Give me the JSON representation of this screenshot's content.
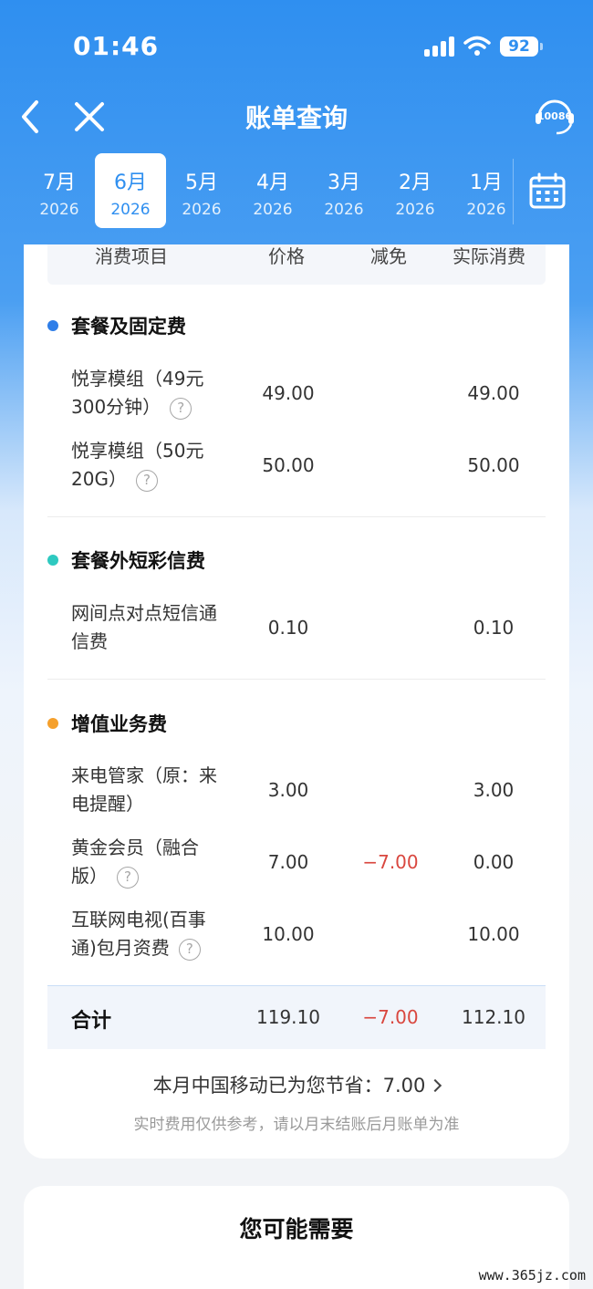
{
  "status_bar": {
    "time": "01:46",
    "battery": "92"
  },
  "nav": {
    "title": "账单查询",
    "hotline": "10086"
  },
  "months": [
    {
      "month": "7月",
      "year": "2026",
      "active": false
    },
    {
      "month": "6月",
      "year": "2026",
      "active": true
    },
    {
      "month": "5月",
      "year": "2026",
      "active": false
    },
    {
      "month": "4月",
      "year": "2026",
      "active": false
    },
    {
      "month": "3月",
      "year": "2026",
      "active": false
    },
    {
      "month": "2月",
      "year": "2026",
      "active": false
    },
    {
      "month": "1月",
      "year": "2026",
      "active": false
    }
  ],
  "table": {
    "headers": {
      "item": "消费项目",
      "price": "价格",
      "discount": "减免",
      "actual": "实际消费"
    }
  },
  "sections": [
    {
      "title": "套餐及固定费",
      "dot_color": "#2f7ee8",
      "items": [
        {
          "name_line1": "悦享模组（49元",
          "name_line2": "300分钟）",
          "price": "49.00",
          "discount": "",
          "actual": "49.00"
        },
        {
          "name_line1": "悦享模组（50元",
          "name_line2": "20G）",
          "price": "50.00",
          "discount": "",
          "actual": "50.00"
        }
      ]
    },
    {
      "title": "套餐外短彩信费",
      "dot_color": "#2ec9c0",
      "items": [
        {
          "name_line1": "网间点对点短信通",
          "name_line2": "信费",
          "price": "0.10",
          "discount": "",
          "actual": "0.10"
        }
      ]
    },
    {
      "title": "增值业务费",
      "dot_color": "#f5a02c",
      "items": [
        {
          "name_line1": "来电管家（原：来",
          "name_line2": "电提醒）",
          "price": "3.00",
          "discount": "",
          "actual": "3.00"
        },
        {
          "name_line1": "黄金会员（融合",
          "name_line2": "版）",
          "price": "7.00",
          "discount": "−7.00",
          "actual": "0.00"
        },
        {
          "name_line1": "互联网电视(百事",
          "name_line2": "通)包月资费",
          "price": "10.00",
          "discount": "",
          "actual": "10.00"
        }
      ]
    }
  ],
  "total": {
    "label": "合计",
    "price": "119.10",
    "discount": "−7.00",
    "actual": "112.10"
  },
  "saving": {
    "text": "本月中国移动已为您节省：7.00"
  },
  "note": "实时费用仅供参考，请以月末结账后月账单为准",
  "recommend": {
    "title": "您可能需要"
  },
  "watermark": "www.365jz.com",
  "colors": {
    "accent": "#2f8ff0",
    "negative": "#d9473f"
  }
}
